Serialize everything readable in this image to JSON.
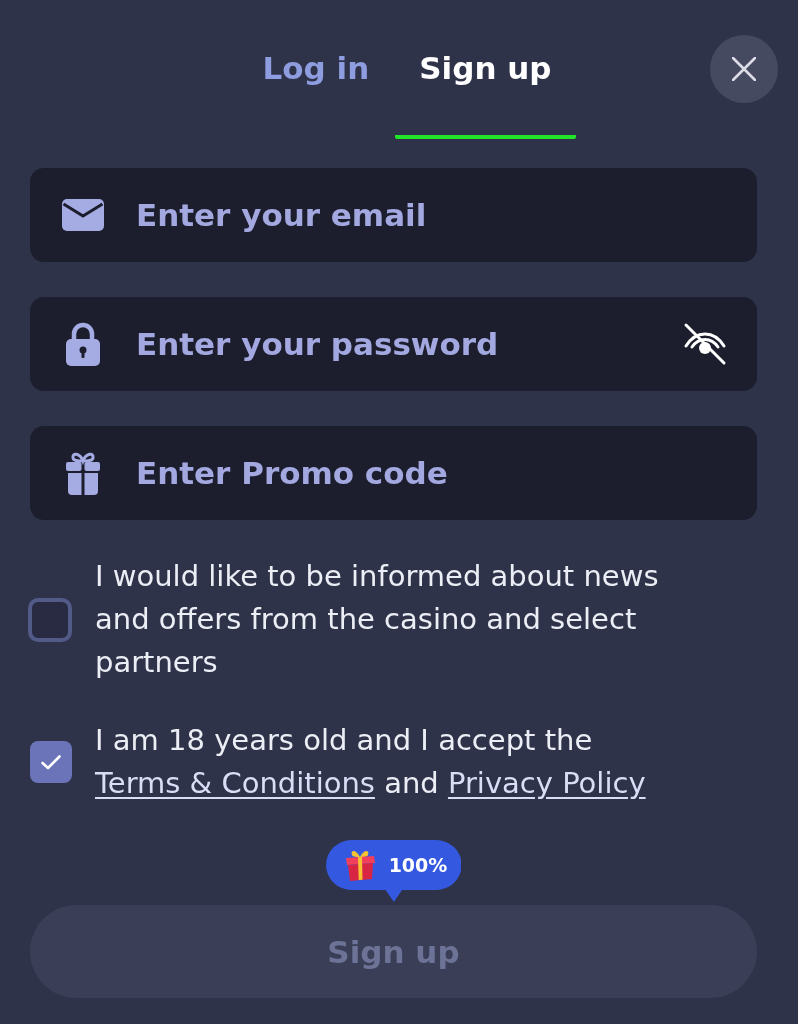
{
  "tabs": [
    {
      "label": "Log in",
      "selected": false
    },
    {
      "label": "Sign up",
      "selected": true
    }
  ],
  "fields": [
    {
      "kind": "email",
      "placeholder": "Enter your email"
    },
    {
      "kind": "password",
      "placeholder": "Enter your password"
    },
    {
      "kind": "promo",
      "placeholder": "Enter Promo code"
    }
  ],
  "consents": [
    {
      "checked": false,
      "segments": [
        {
          "kind": "text",
          "text": "I would like to be informed about news and offers from the casino and select partners"
        }
      ]
    },
    {
      "checked": true,
      "segments": [
        {
          "kind": "text",
          "text": "I am 18 years old and I accept the "
        },
        {
          "kind": "link",
          "text": "Terms & Conditions"
        },
        {
          "kind": "text",
          "text": " and "
        },
        {
          "kind": "link",
          "text": "Privacy Policy"
        }
      ]
    }
  ],
  "bonus_badge": {
    "label": "100%"
  },
  "submit_button": {
    "label": "Sign up",
    "disabled": true
  }
}
